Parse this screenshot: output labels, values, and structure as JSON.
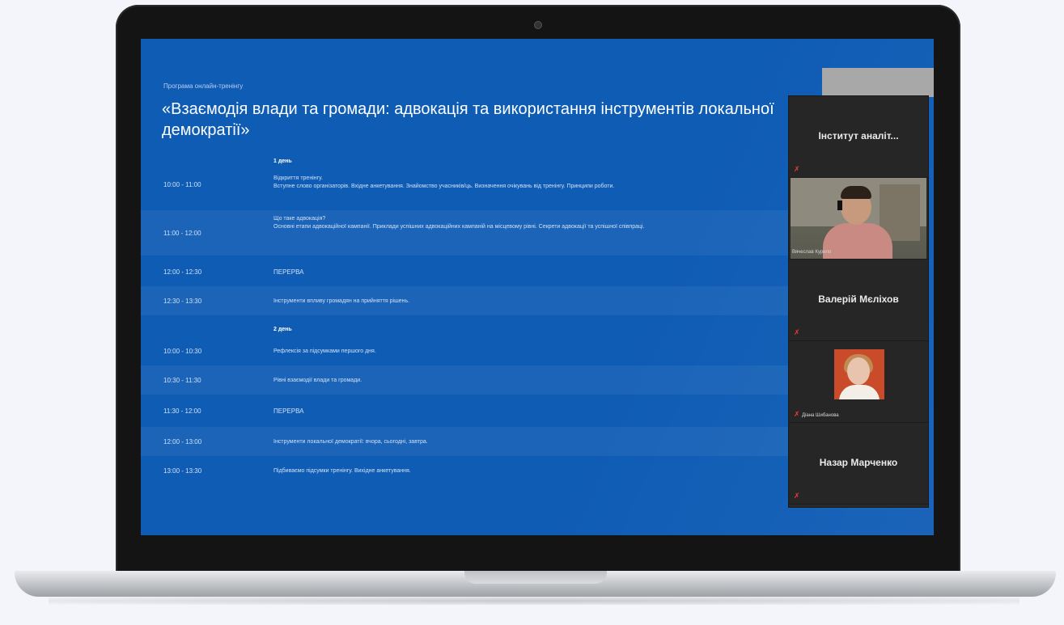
{
  "slide": {
    "subtitle": "Програма онлайн-тренінгу",
    "title": "«Взаємодія влади та громади: адвокація та використання інструментів локальної демократії»",
    "day1": "1 день",
    "day2": "2 день",
    "rows": [
      {
        "time": "10:00 - 11:00",
        "line1": "Відкриття тренінгу.",
        "line2": "Вступне слово організаторів. Вхідне анкетування. Знайомство учасників/ць. Визначення очікувань від тренінгу. Принципи роботи."
      },
      {
        "time": "11:00 - 12:00",
        "line1": "Що таке адвокація?",
        "line2": "Основні етапи адвокаційної кампанії. Приклади успішних адвокаційних кампаній на місцевому рівні. Секрети адвокації та успішної співпраці."
      },
      {
        "time": "12:00 - 12:30",
        "line1": "ПЕРЕРВА",
        "line2": ""
      },
      {
        "time": "12:30 - 13:30",
        "line1": "Інструменти впливу громадян на прийняття рішень.",
        "line2": ""
      },
      {
        "time": "10:00 - 10:30",
        "line1": "Рефлексія за підсумками першого дня.",
        "line2": ""
      },
      {
        "time": "10:30 - 11:30",
        "line1": "Рівні взаємодії влади та громади.",
        "line2": ""
      },
      {
        "time": "11:30 - 12:00",
        "line1": "ПЕРЕРВА",
        "line2": ""
      },
      {
        "time": "12:00 - 13:00",
        "line1": "Інструменти локальної демократії: вчора, сьогодні, завтра.",
        "line2": ""
      },
      {
        "time": "13:00 - 13:30",
        "line1": "Підбиваємо підсумки тренінгу. Вихідне анкетування.",
        "line2": ""
      }
    ]
  },
  "participants": {
    "p1": "Інститут аналіт...",
    "p2_caption": "Вячеслав Курило",
    "p3": "Валерій Мєліхов",
    "p4_caption": "Діана Шибанова",
    "p5": "Назар Марченко",
    "mic_glyph": "✗"
  },
  "colors": {
    "slide_bg": "#0f5cb5",
    "panel_bg": "#262626",
    "muted_mic": "#e53b3b"
  }
}
